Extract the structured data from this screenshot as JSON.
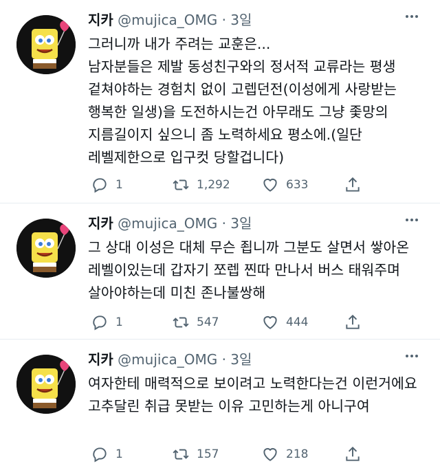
{
  "tweets": [
    {
      "name": "지카",
      "handle": "@mujica_OMG",
      "time": "· 3일",
      "text": "그러니까 내가 주려는 교훈은...\n남자분들은 제발 동성친구와의 정서적 교류라는 평생 겉쳐야하는 경험치 없이 고렙던전(이성에게 사랑받는 행복한 일생)을 도전하시는건 아무래도 그냥 좇망의 지름길이지 싶으니 좀 노력하세요 평소에.(일단 레벨제한으로 입구컷 당할겁니다)",
      "replies": "1",
      "retweets": "1,292",
      "likes": "633"
    },
    {
      "name": "지카",
      "handle": "@mujica_OMG",
      "time": "· 3일",
      "text": "그 상대 이성은 대체 무슨 죕니까 그분도 살면서 쌓아온 레벨이있는데 갑자기 쪼렙 찐따 만나서 버스 태워주며 살아야하는데 미친 존나불쌍해",
      "replies": "1",
      "retweets": "547",
      "likes": "444"
    },
    {
      "name": "지카",
      "handle": "@mujica_OMG",
      "time": "· 3일",
      "text": "여자한테 매력적으로 보이려고 노력한다는건 이런거에요 고추달린 취급 못받는 이유 고민하는게 아니구여",
      "replies": "1",
      "retweets": "157",
      "likes": "218"
    }
  ],
  "icons": {
    "reply": "speech-bubble-icon",
    "retweet": "retweet-arrows-icon",
    "like": "heart-outline-icon",
    "share": "share-upload-icon",
    "more": "more-dots-icon",
    "avatar": "spongebob-with-balloon"
  },
  "colors": {
    "text": "#0f1419",
    "secondary": "#536471",
    "divider": "#e6ecf0",
    "avatar_bg": "#111111",
    "sponge": "#f5e04a",
    "balloon": "#e8457a"
  }
}
